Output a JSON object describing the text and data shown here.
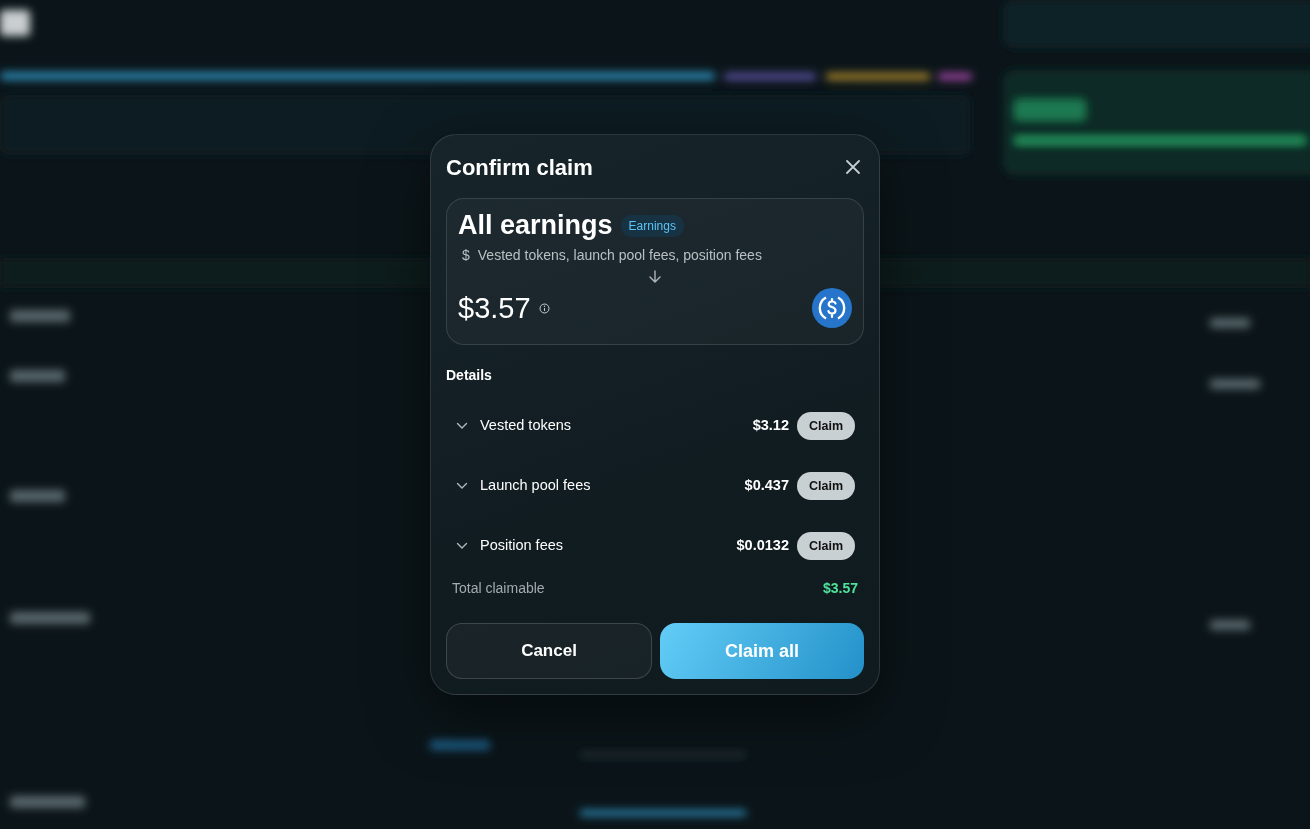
{
  "modal": {
    "title": "Confirm claim",
    "source": {
      "title": "All earnings",
      "tag": "Earnings",
      "currency_symbol": "$",
      "description": "Vested tokens, launch pool fees, position fees",
      "amount": "$3.57"
    },
    "details_label": "Details",
    "details": [
      {
        "label": "Vested tokens",
        "amount": "$3.12",
        "action": "Claim",
        "expanded": false
      },
      {
        "label": "Launch pool fees",
        "amount": "$0.437",
        "action": "Claim",
        "expanded": false
      },
      {
        "label": "Position fees",
        "amount": "$0.0132",
        "action": "Claim",
        "expanded": false
      }
    ],
    "total": {
      "label": "Total claimable",
      "amount": "$3.57"
    },
    "buttons": [
      {
        "label": "Cancel",
        "kind": "secondary"
      },
      {
        "label": "Claim all",
        "kind": "primary"
      }
    ]
  }
}
